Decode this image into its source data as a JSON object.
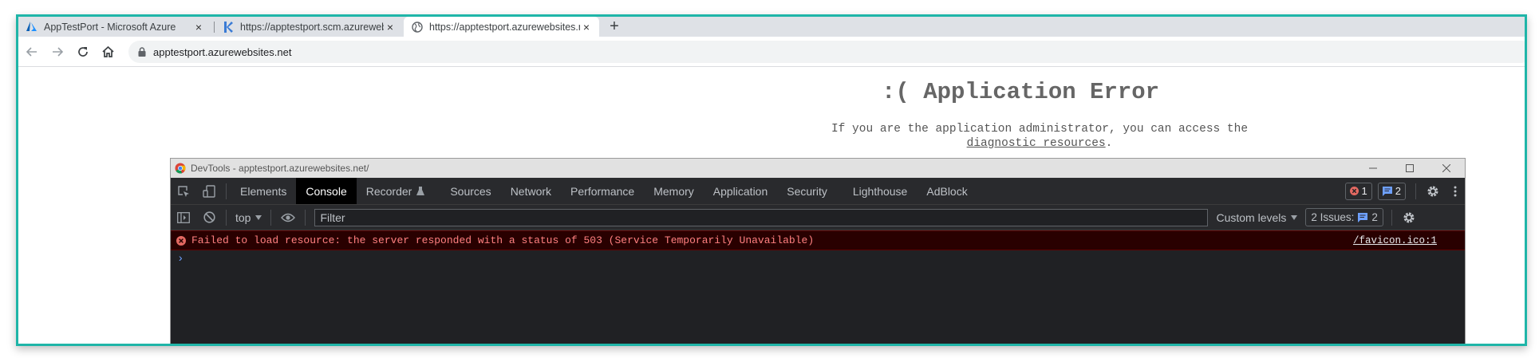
{
  "browser": {
    "tabs": [
      {
        "label": "AppTestPort - Microsoft Azure",
        "icon": "azure-icon",
        "active": false
      },
      {
        "label": "https://apptestport.scm.azurewebsites.net",
        "icon": "kudu-icon",
        "active": false
      },
      {
        "label": "https://apptestport.azurewebsites.net",
        "icon": "globe-icon",
        "active": true
      }
    ],
    "new_tab_glyph": "+",
    "close_glyph": "×",
    "address": "apptestport.azurewebsites.net"
  },
  "page": {
    "error_title": ":( Application Error",
    "error_desc_prefix": "If you are the application administrator, you can access the",
    "error_link": "diagnostic resources",
    "error_desc_suffix": "."
  },
  "devtools": {
    "window_title": "DevTools - apptestport.azurewebsites.net/",
    "tabs": [
      "Elements",
      "Console",
      "Recorder",
      "Sources",
      "Network",
      "Performance",
      "Memory",
      "Application",
      "Security",
      "Lighthouse",
      "AdBlock"
    ],
    "active_tab": "Console",
    "error_count": "1",
    "message_count": "2",
    "context": "top",
    "filter_placeholder": "Filter",
    "levels_label": "Custom levels",
    "issues_label": "2 Issues:",
    "issues_count": "2",
    "error_message": "Failed to load resource: the server responded with a status of 503 (Service Temporarily Unavailable)",
    "error_source": "/favicon.ico:1",
    "prompt_glyph": "›"
  },
  "colors": {
    "frame_border": "#1fb5a8",
    "devtools_bg": "#202124",
    "error_text": "#ff8080",
    "error_bg": "#290000"
  }
}
